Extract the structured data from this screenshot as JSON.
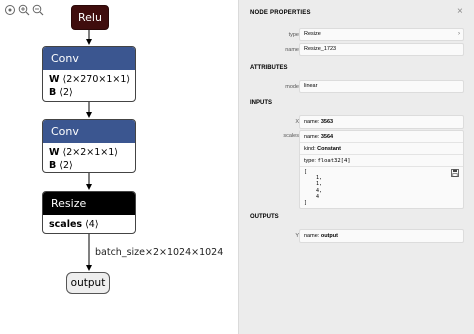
{
  "graph": {
    "relu": {
      "label": "Relu"
    },
    "conv1": {
      "title": "Conv",
      "attrs": [
        {
          "name": "W",
          "value": "⟨2×270×1×1⟩"
        },
        {
          "name": "B",
          "value": "⟨2⟩"
        }
      ]
    },
    "conv2": {
      "title": "Conv",
      "attrs": [
        {
          "name": "W",
          "value": "⟨2×2×1×1⟩"
        },
        {
          "name": "B",
          "value": "⟨2⟩"
        }
      ]
    },
    "resize": {
      "title": "Resize",
      "attrs": [
        {
          "name": "scales",
          "value": "⟨4⟩"
        }
      ]
    },
    "edge_label": "batch_size×2×1024×1024",
    "output": {
      "label": "output"
    }
  },
  "toolbar": {
    "icons": [
      "home-icon",
      "zoom-in-icon",
      "zoom-out-icon"
    ]
  },
  "sidebar": {
    "title": "NODE PROPERTIES",
    "close": "×",
    "props": [
      {
        "label": "type",
        "value": "Resize"
      },
      {
        "label": "name",
        "value": "Resize_1723"
      }
    ],
    "attributes_header": "ATTRIBUTES",
    "attributes": [
      {
        "label": "mode",
        "value": "linear"
      }
    ],
    "inputs_header": "INPUTS",
    "inputs": {
      "x_label": "X",
      "x_name_key": "name:",
      "x_name": "3563",
      "scales_label": "scales",
      "scales_name_key": "name:",
      "scales_name": "3564",
      "kind_key": "kind:",
      "kind": "Constant",
      "type_key": "type:",
      "type": "float32[4]",
      "tensor": "[\n    1,\n    1,\n    4,\n    4\n]"
    },
    "outputs_header": "OUTPUTS",
    "outputs": {
      "y_label": "Y",
      "name_key": "name:",
      "name": "output"
    }
  }
}
